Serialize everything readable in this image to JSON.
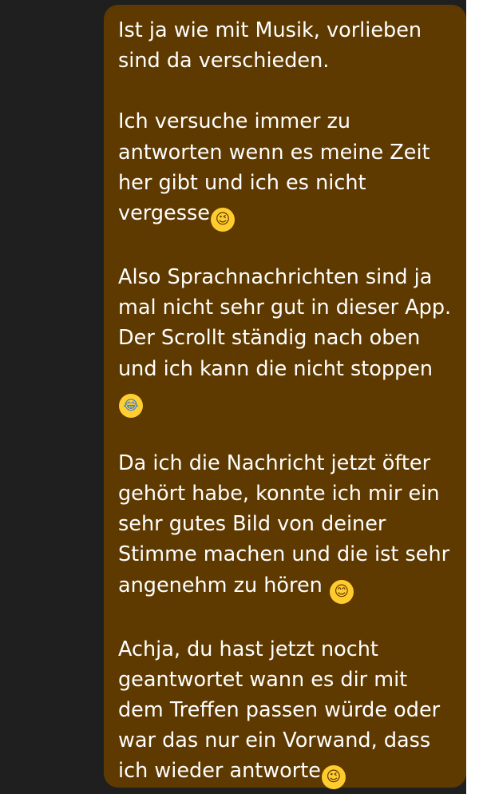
{
  "chat": {
    "message": {
      "p1": {
        "line1": "Ist ja wie mit Musik, vorlieben",
        "line2": "sind da verschieden."
      },
      "p2": {
        "line1": "Ich versuche immer zu",
        "line2": "antworten wenn es meine Zeit",
        "line3": "her gibt und ich es nicht",
        "line4": "vergesse",
        "emoji": "😉",
        "emoji_icon": "wink-emoji-icon"
      },
      "p3": {
        "line1": "Also Sprachnachrichten sind ja",
        "line2": "mal nicht sehr gut in dieser App.",
        "line3": "Der Scrollt ständig nach oben",
        "line4": "und ich kann die nicht stoppen",
        "emoji": "😂",
        "emoji_icon": "tears-of-joy-emoji-icon"
      },
      "p4": {
        "line1": "Da ich die Nachricht jetzt öfter",
        "line2": "gehört habe, konnte ich mir ein",
        "line3": "sehr gutes Bild von deiner",
        "line4": "Stimme machen und die ist sehr",
        "line5": "angenehm zu hören ",
        "emoji": "😊",
        "emoji_icon": "smiling-emoji-icon"
      },
      "p5": {
        "line1": "Achja, du hast jetzt nocht",
        "line2": "geantwortet wann es dir mit",
        "line3": "dem Treffen passen würde oder",
        "line4": "war das nur ein Vorwand, dass",
        "line5": "ich wieder antworte",
        "emoji": "😉",
        "emoji_icon": "wink-emoji-icon"
      }
    }
  },
  "colors": {
    "chat_background": "#1f1f1f",
    "bubble_background": "#5f3a00",
    "text": "#ffffff",
    "emoji_yellow": "#ffcc2f"
  }
}
